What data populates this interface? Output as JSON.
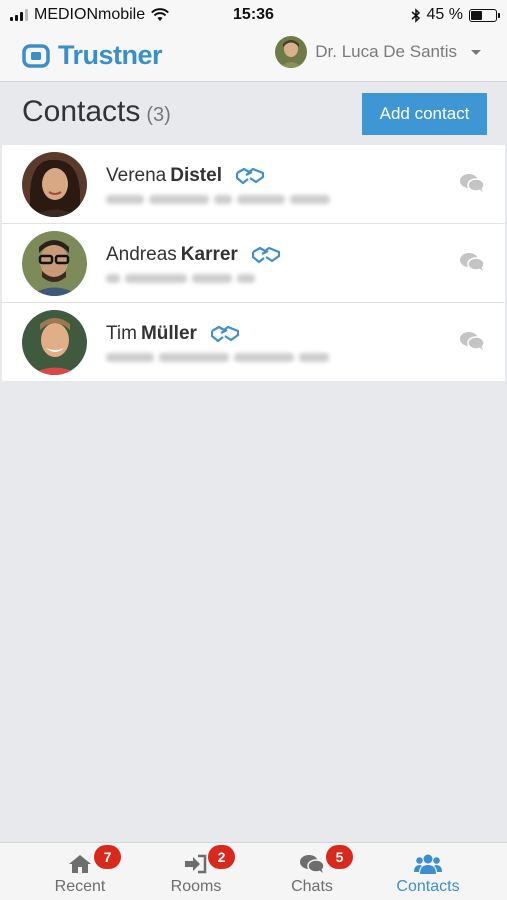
{
  "status_bar": {
    "carrier": "MEDIONmobile",
    "time": "15:36",
    "battery_percent": "45 %",
    "battery_level": 0.45
  },
  "header": {
    "brand": "Trustner",
    "user_name": "Dr. Luca De Santis"
  },
  "page": {
    "title": "Contacts",
    "count": "(3)",
    "add_button": "Add contact"
  },
  "contacts": [
    {
      "first": "Verena",
      "last": "Distel"
    },
    {
      "first": "Andreas",
      "last": "Karrer"
    },
    {
      "first": "Tim",
      "last": "Müller"
    }
  ],
  "tabs": [
    {
      "label": "Recent",
      "badge": "7",
      "icon": "home-icon"
    },
    {
      "label": "Rooms",
      "badge": "2",
      "icon": "sign-in-icon"
    },
    {
      "label": "Chats",
      "badge": "5",
      "icon": "chat-bubbles-icon"
    },
    {
      "label": "Contacts",
      "badge": "",
      "icon": "users-icon"
    }
  ],
  "colors": {
    "accent": "#3e96d4",
    "badge": "#d9291d",
    "background": "#e8e9ec"
  }
}
